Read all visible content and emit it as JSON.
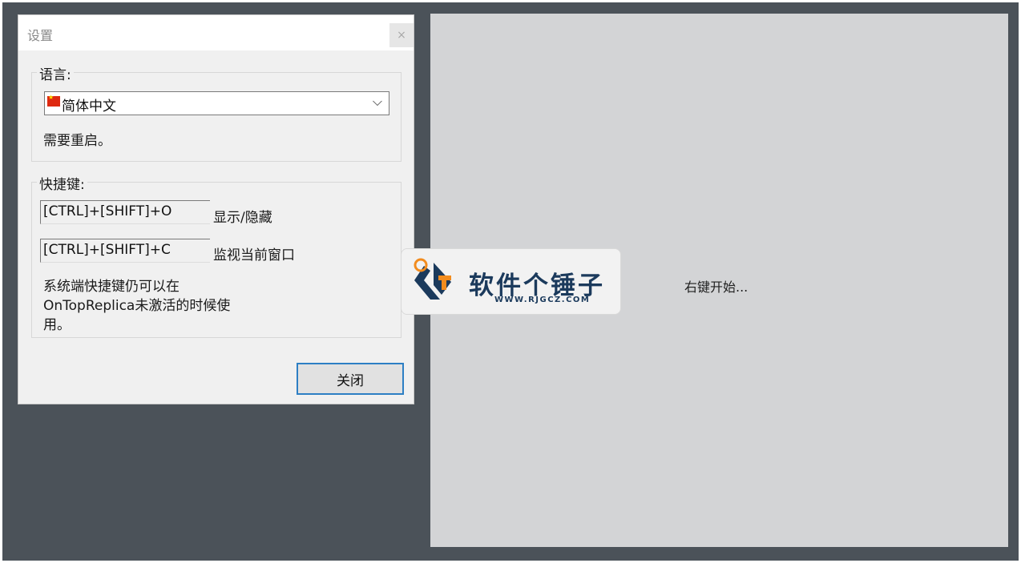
{
  "dialog": {
    "title": "设置",
    "close_glyph": "×",
    "language_group": {
      "label": "语言:",
      "selected": "简体中文",
      "flag": "flag-cn-icon",
      "note": "需要重启。"
    },
    "hotkey_group": {
      "label": "快捷键:",
      "hotkeys": [
        {
          "keys": "[CTRL]+[SHIFT]+O",
          "action": "显示/隐藏"
        },
        {
          "keys": "[CTRL]+[SHIFT]+C",
          "action": "监视当前窗口"
        }
      ],
      "note_lines": [
        "系统端快捷键仍可以在",
        "OnTopReplica未激活的时候使",
        "用。"
      ]
    },
    "close_button": "关闭"
  },
  "replica": {
    "hint": "右键开始..."
  },
  "watermark": {
    "name": "软件个锤子",
    "url": "WWW.RJGCZ.COM",
    "colors": {
      "navy": "#1b3a5c",
      "orange": "#f28c1e"
    }
  }
}
